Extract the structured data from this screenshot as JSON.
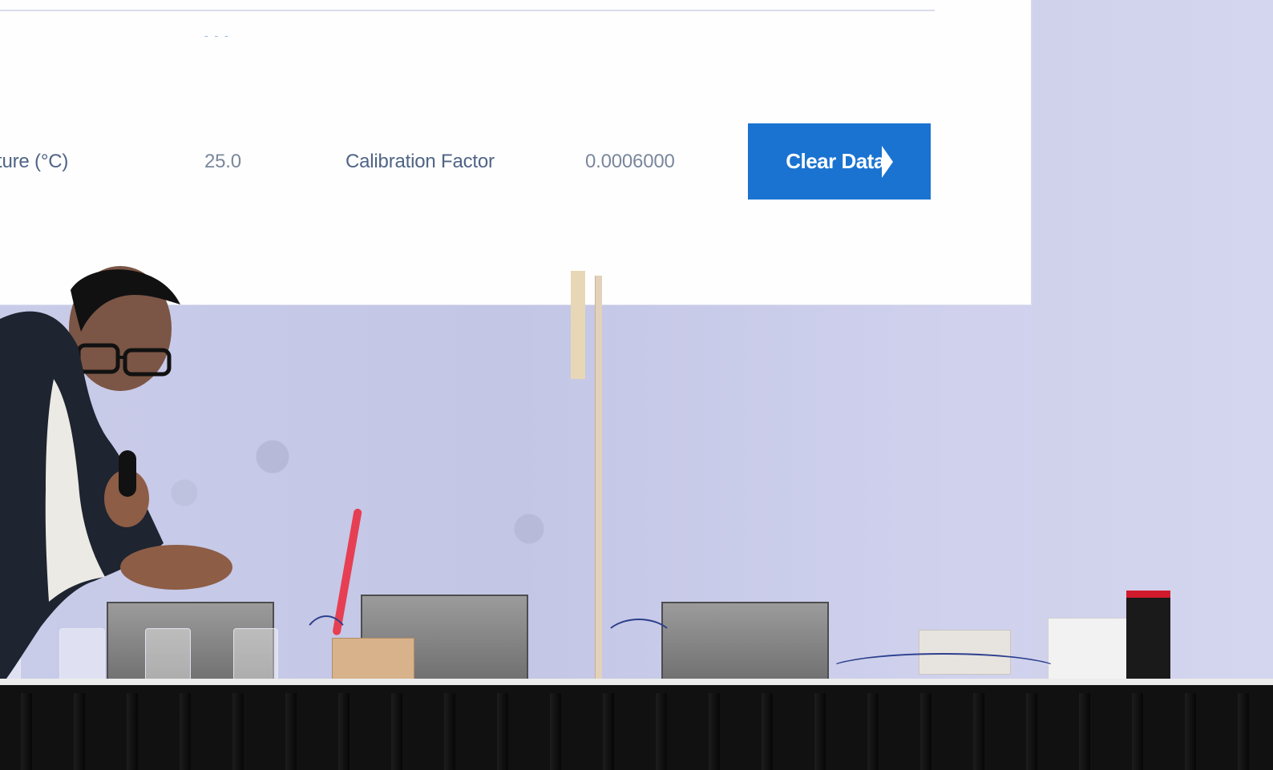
{
  "screen": {
    "dash_text": "- - -",
    "temperature_label": "ture (°C)",
    "temperature_value": "25.0",
    "calibration_label": "Calibration Factor",
    "calibration_value": "0.0006000",
    "button_label": "Clear Data"
  },
  "scene": {
    "person_description": "presenter with microphone",
    "colors": {
      "button_blue": "#1a73d1",
      "screen_background": "#fefefe",
      "wall_background": "#c7c9e6",
      "table_black": "#111111"
    }
  }
}
